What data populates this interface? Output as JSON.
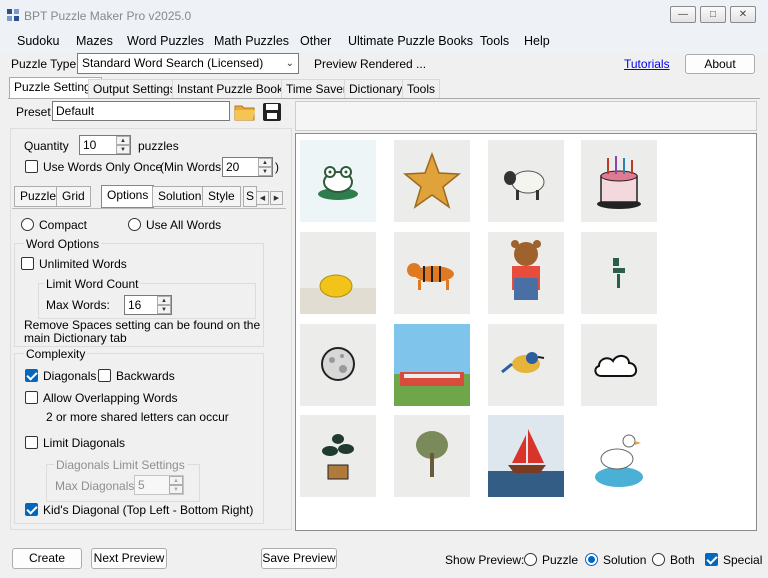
{
  "window": {
    "title": "BPT Puzzle Maker Pro v2025.0"
  },
  "menu": [
    "Sudoku",
    "Mazes",
    "Word Puzzles",
    "Math Puzzles",
    "Other",
    "Ultimate Puzzle Books",
    "Tools",
    "Help"
  ],
  "toolbar": {
    "puzzle_type_label": "Puzzle Type",
    "puzzle_type_value": "Standard Word Search (Licensed)",
    "preview_status": "Preview Rendered ...",
    "tutorials_link": "Tutorials",
    "about_button": "About"
  },
  "tabs": [
    "Puzzle Settings",
    "Output Settings",
    "Instant Puzzle Books",
    "Time Saver",
    "Dictionary",
    "Tools"
  ],
  "settings": {
    "preset_label": "Preset",
    "preset_value": "Default",
    "quantity_label": "Quantity",
    "quantity_value": "10",
    "quantity_unit": "puzzles",
    "use_words_once": "Use Words Only Once",
    "min_words_label": "(Min Words:",
    "min_words_value": "20",
    "min_words_close": ")",
    "subtabs": [
      "Puzzle",
      "Grid",
      "Options",
      "Solution",
      "Style",
      "S"
    ],
    "compact": "Compact",
    "use_all_words": "Use All Words",
    "word_options_title": "Word Options",
    "unlimited_words": "Unlimited Words",
    "limit_word_count_title": "Limit Word Count",
    "max_words_label": "Max Words:",
    "max_words_value": "16",
    "remove_spaces_note": "Remove Spaces setting can be found on the main Dictionary tab",
    "complexity_title": "Complexity",
    "diagonals": "Diagonals",
    "backwards": "Backwards",
    "allow_overlapping": "Allow Overlapping Words",
    "overlap_note": "2 or more shared letters can occur",
    "limit_diagonals": "Limit Diagonals",
    "diagonals_limit_title": "Diagonals Limit Settings",
    "max_diagonals_label": "Max Diagonals",
    "max_diagonals_value": "5",
    "kids_diagonal": "Kid's Diagonal (Top Left - Bottom Right)"
  },
  "preview_images": [
    "frog-icon",
    "star-icon",
    "sheep-icon",
    "cake-icon",
    "lemon-icon",
    "tiger-icon",
    "bear-icon",
    "chair-icon",
    "moon-icon",
    "train-icon",
    "bird-icon",
    "cloud-icon",
    "plant-icon",
    "tree-icon",
    "sailboat-icon",
    "duck-icon"
  ],
  "bottom": {
    "create": "Create",
    "next_preview": "Next Preview",
    "save_preview": "Save Preview",
    "show_preview_label": "Show Preview:",
    "opt_puzzle": "Puzzle",
    "opt_solution": "Solution",
    "opt_both": "Both",
    "special": "Special"
  },
  "colors": {
    "accent": "#0067c0",
    "link": "#0000ee"
  }
}
